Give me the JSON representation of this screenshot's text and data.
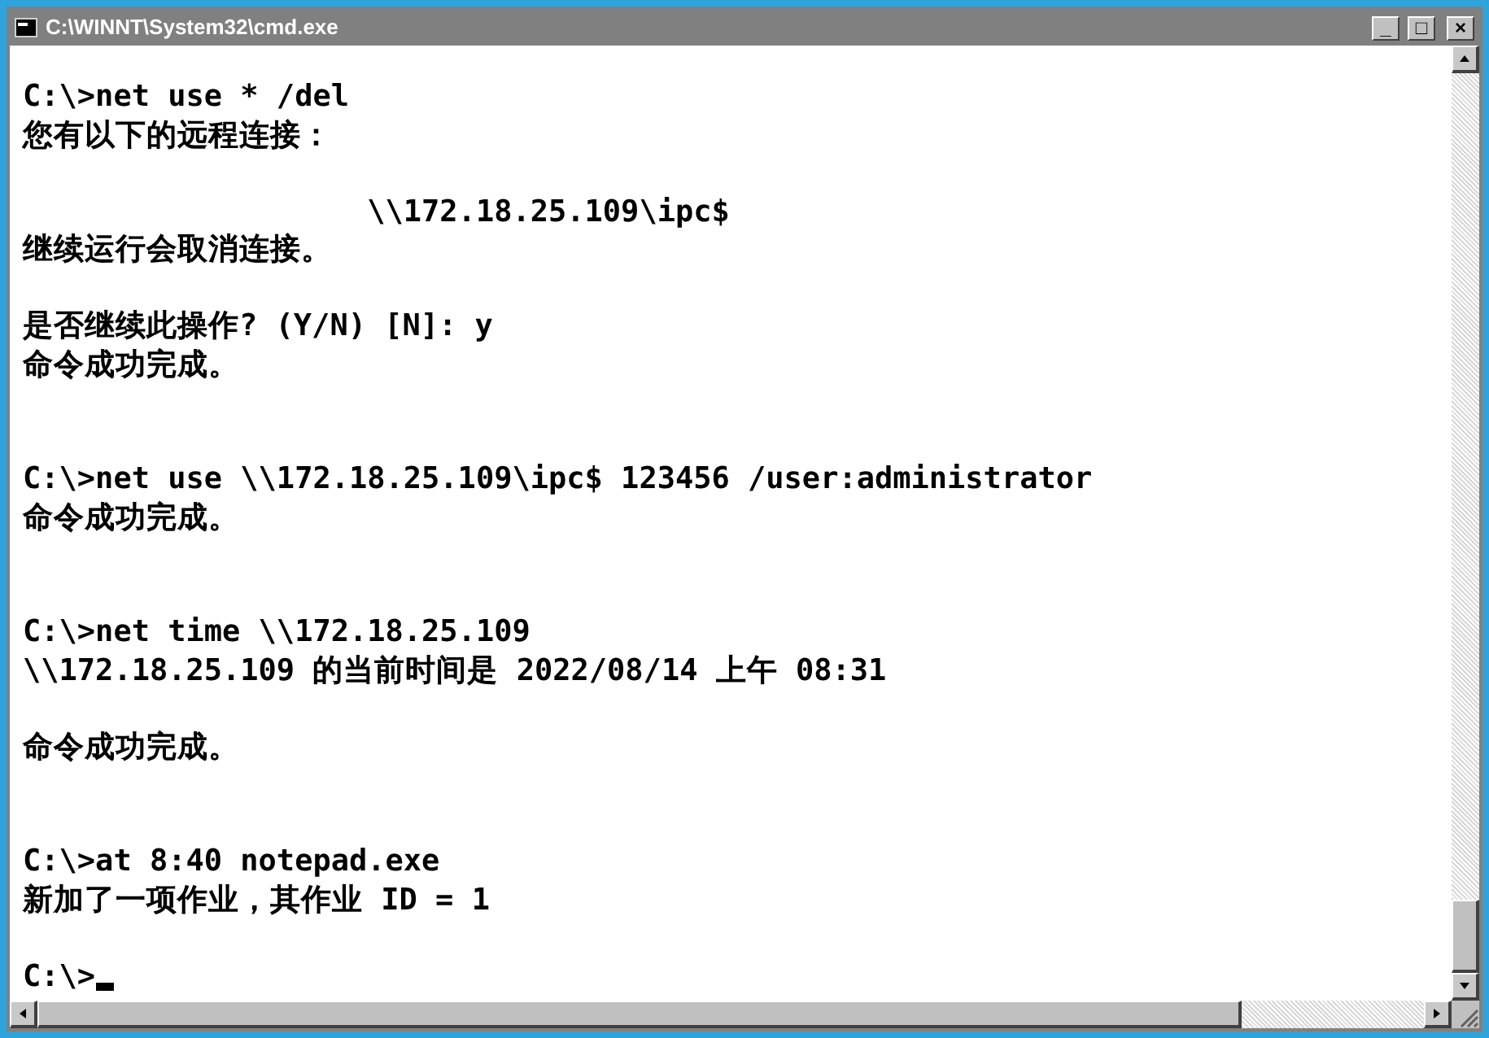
{
  "window": {
    "title": "C:\\WINNT\\System32\\cmd.exe",
    "controls": [
      "_",
      "□",
      "×"
    ]
  },
  "console": {
    "lines": [
      {
        "kind": "text",
        "text": "C:\\>net use * /del"
      },
      {
        "kind": "text",
        "text": "您有以下的远程连接："
      },
      {
        "kind": "blank"
      },
      {
        "kind": "text",
        "text": "                   \\\\172.18.25.109\\ipc$"
      },
      {
        "kind": "text",
        "text": "继续运行会取消连接。"
      },
      {
        "kind": "blank"
      },
      {
        "kind": "text",
        "text": "是否继续此操作? (Y/N) [N]: y"
      },
      {
        "kind": "text",
        "text": "命令成功完成。"
      },
      {
        "kind": "blank"
      },
      {
        "kind": "blank"
      },
      {
        "kind": "text",
        "text": "C:\\>net use \\\\172.18.25.109\\ipc$ 123456 /user:administrator"
      },
      {
        "kind": "text",
        "text": "命令成功完成。"
      },
      {
        "kind": "blank"
      },
      {
        "kind": "blank"
      },
      {
        "kind": "text",
        "text": "C:\\>net time \\\\172.18.25.109"
      },
      {
        "kind": "text",
        "text": "\\\\172.18.25.109 的当前时间是 2022/08/14 上午 08:31"
      },
      {
        "kind": "blank"
      },
      {
        "kind": "text",
        "text": "命令成功完成。"
      },
      {
        "kind": "blank"
      },
      {
        "kind": "blank"
      },
      {
        "kind": "text",
        "text": "C:\\>at 8:40 notepad.exe"
      },
      {
        "kind": "text",
        "text": "新加了一项作业，其作业 ID = 1"
      },
      {
        "kind": "blank"
      },
      {
        "kind": "prompt",
        "text": "C:\\>",
        "cursor": true
      }
    ]
  }
}
